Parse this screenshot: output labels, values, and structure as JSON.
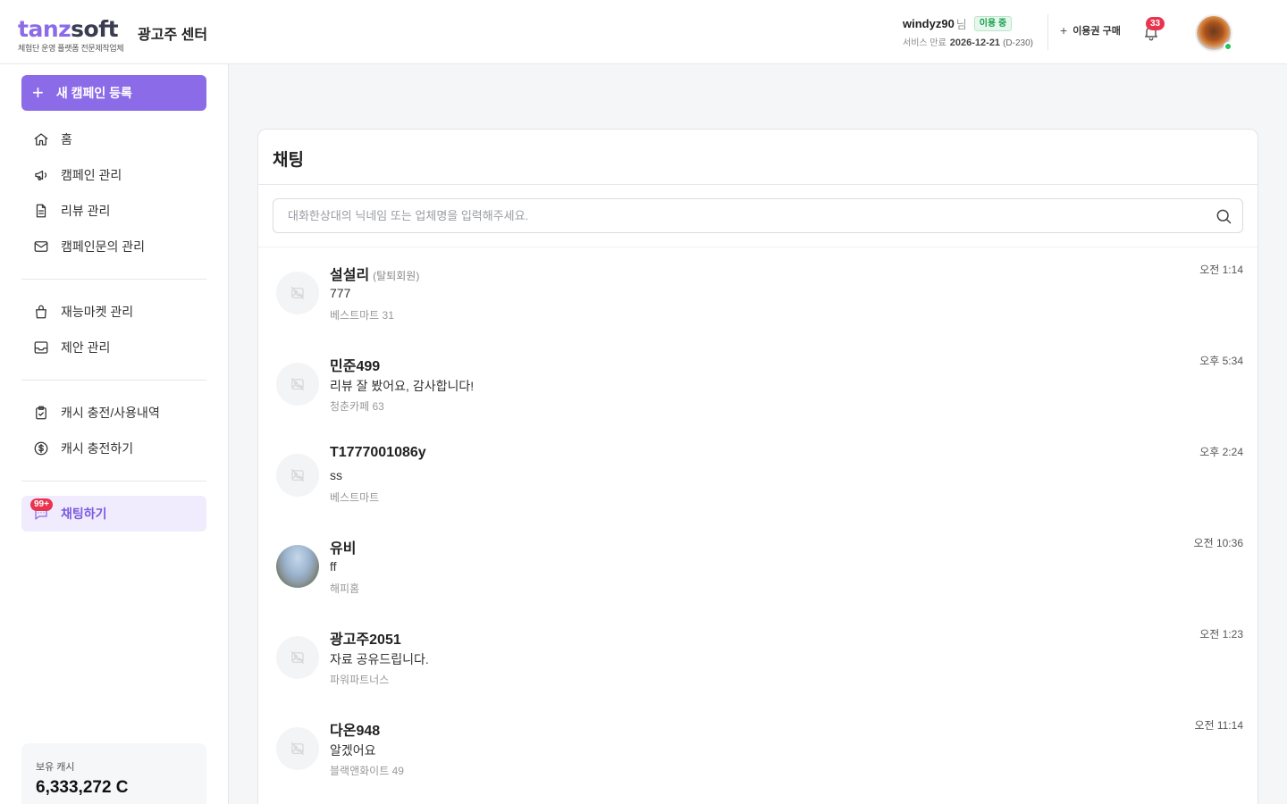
{
  "header": {
    "logo_part1": "tanz",
    "logo_part2": "soft",
    "logo_sub": "체험단 운영 플랫폼 전문제작업체",
    "center_name": "광고주 센터",
    "user_id": "windyz90",
    "user_suffix": "님",
    "status": "이용 중",
    "service_end_label": "서비스 만료",
    "service_end_date": "2026-12-21",
    "dday": "(D-230)",
    "buy_label": "이용권 구매",
    "notification_count": "33"
  },
  "sidebar": {
    "new_campaign": "새 캠페인 등록",
    "items": [
      {
        "label": "홈"
      },
      {
        "label": "캠페인 관리"
      },
      {
        "label": "리뷰 관리"
      },
      {
        "label": "캠페인문의 관리"
      },
      {
        "label": "재능마켓 관리"
      },
      {
        "label": "제안 관리"
      },
      {
        "label": "캐시 충전/사용내역"
      },
      {
        "label": "캐시 충전하기"
      },
      {
        "label": "채팅하기"
      }
    ],
    "chat_badge": "99+",
    "cash_label": "보유 캐시",
    "cash_value": "6,333,272 C"
  },
  "main": {
    "title": "채팅",
    "search_placeholder": "대화한상대의 닉네임 또는 업체명을 입력해주세요.",
    "chats": [
      {
        "name": "설설리",
        "tag": "(탈퇴회원)",
        "message": "777",
        "shop": "베스트마트 31",
        "time": "오전 1:14"
      },
      {
        "name": "민준499",
        "tag": "",
        "message": "리뷰 잘 봤어요, 감사합니다!",
        "shop": "청춘카페 63",
        "time": "오후 5:34"
      },
      {
        "name": "T1777001086y",
        "tag": "",
        "message": "ss",
        "shop": "베스트마트",
        "time": "오후 2:24"
      },
      {
        "name": "유비",
        "tag": "",
        "message": "ff",
        "shop": "해피홈",
        "time": "오전 10:36"
      },
      {
        "name": "광고주2051",
        "tag": "",
        "message": "자료 공유드립니다.",
        "shop": "파워파트너스",
        "time": "오전 1:23"
      },
      {
        "name": "다온948",
        "tag": "",
        "message": "알겠어요",
        "shop": "블랙앤화이트 49",
        "time": "오전 11:14"
      }
    ]
  },
  "colors": {
    "accent": "#8b6be8",
    "badge_red": "#e8344e",
    "status_green": "#14a04a",
    "online_dot": "#22c55e"
  }
}
